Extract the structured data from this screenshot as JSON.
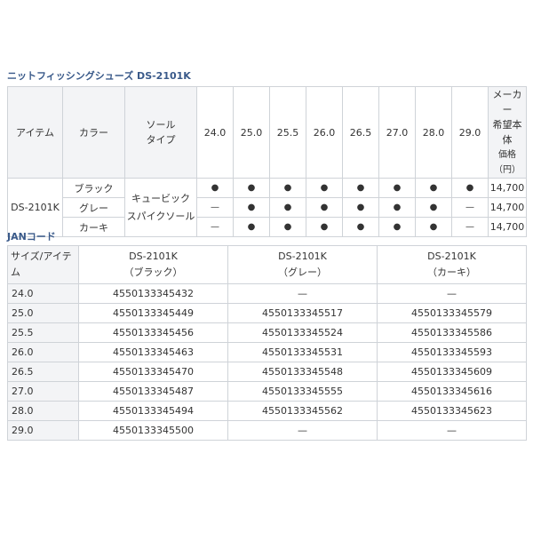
{
  "spec_section": {
    "title": "ニットフィッシングシューズ DS-2101K",
    "headers": {
      "item": "アイテム",
      "color": "カラー",
      "sole_line1": "ソール",
      "sole_line2": "タイプ",
      "sizes": [
        "24.0",
        "25.0",
        "25.5",
        "26.0",
        "26.5",
        "27.0",
        "28.0",
        "29.0"
      ],
      "price_line1": "メーカー",
      "price_line2": "希望本体",
      "price_line3": "価格（円）"
    },
    "item_name": "DS-2101K",
    "sole_line1": "キュービック",
    "sole_line2": "スパイクソール",
    "rows": [
      {
        "color": "ブラック",
        "marks": [
          "●",
          "●",
          "●",
          "●",
          "●",
          "●",
          "●",
          "●"
        ],
        "price": "14,700"
      },
      {
        "color": "グレー",
        "marks": [
          "—",
          "●",
          "●",
          "●",
          "●",
          "●",
          "●",
          "—"
        ],
        "price": "14,700"
      },
      {
        "color": "カーキ",
        "marks": [
          "—",
          "●",
          "●",
          "●",
          "●",
          "●",
          "●",
          "—"
        ],
        "price": "14,700"
      }
    ]
  },
  "jan_section": {
    "title": "JANコード",
    "headers": {
      "size": "サイズ/アイテム",
      "cols": [
        {
          "line1": "DS-2101K",
          "line2": "（ブラック）"
        },
        {
          "line1": "DS-2101K",
          "line2": "（グレー）"
        },
        {
          "line1": "DS-2101K",
          "line2": "（カーキ）"
        }
      ]
    },
    "rows": [
      {
        "size": "24.0",
        "codes": [
          "4550133345432",
          "—",
          "—"
        ]
      },
      {
        "size": "25.0",
        "codes": [
          "4550133345449",
          "4550133345517",
          "4550133345579"
        ]
      },
      {
        "size": "25.5",
        "codes": [
          "4550133345456",
          "4550133345524",
          "4550133345586"
        ]
      },
      {
        "size": "26.0",
        "codes": [
          "4550133345463",
          "4550133345531",
          "4550133345593"
        ]
      },
      {
        "size": "26.5",
        "codes": [
          "4550133345470",
          "4550133345548",
          "4550133345609"
        ]
      },
      {
        "size": "27.0",
        "codes": [
          "4550133345487",
          "4550133345555",
          "4550133345616"
        ]
      },
      {
        "size": "28.0",
        "codes": [
          "4550133345494",
          "4550133345562",
          "4550133345623"
        ]
      },
      {
        "size": "29.0",
        "codes": [
          "4550133345500",
          "—",
          "—"
        ]
      }
    ]
  }
}
